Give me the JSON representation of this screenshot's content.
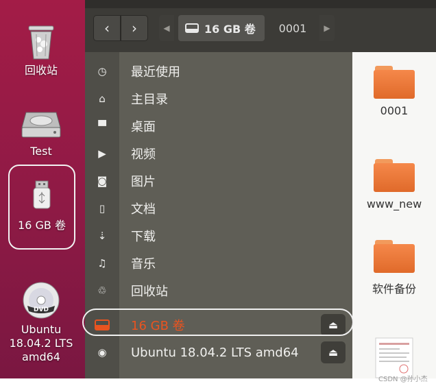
{
  "desktop": {
    "items": [
      {
        "label": "回收站",
        "icon": "trash-icon"
      },
      {
        "label": "Test",
        "icon": "hard-drive-icon"
      },
      {
        "label": "16 GB 卷",
        "icon": "usb-drive-icon",
        "selected": true
      },
      {
        "label": "Ubuntu 18.04.2 LTS amd64",
        "icon": "dvd-icon"
      }
    ]
  },
  "toolbar": {
    "back_icon": "‹",
    "forward_icon": "›",
    "path_left_icon": "◀",
    "path_right_icon": "▶",
    "crumbs": [
      {
        "label": "16 GB 卷",
        "icon": "drive-icon",
        "active": true
      },
      {
        "label": "0001",
        "active": false
      }
    ]
  },
  "sidebar": {
    "items": [
      {
        "label": "最近使用",
        "icon": "clock-icon",
        "glyph": "◷"
      },
      {
        "label": "主目录",
        "icon": "home-icon",
        "glyph": "⌂"
      },
      {
        "label": "桌面",
        "icon": "desktop-folder-icon",
        "glyph": "▀"
      },
      {
        "label": "视频",
        "icon": "video-icon",
        "glyph": "▶"
      },
      {
        "label": "图片",
        "icon": "camera-icon",
        "glyph": "◙"
      },
      {
        "label": "文档",
        "icon": "document-icon",
        "glyph": "▯"
      },
      {
        "label": "下载",
        "icon": "download-icon",
        "glyph": "⇣"
      },
      {
        "label": "音乐",
        "icon": "music-icon",
        "glyph": "♫"
      },
      {
        "label": "回收站",
        "icon": "trash-icon",
        "glyph": "♲"
      },
      {
        "label": "16 GB 卷",
        "icon": "drive-icon",
        "glyph": "▬",
        "active": true,
        "eject": true
      },
      {
        "label": "Ubuntu 18.04.2 LTS amd64",
        "icon": "disc-icon",
        "glyph": "◉",
        "eject": true
      }
    ],
    "eject_glyph": "⏏"
  },
  "content": {
    "items": [
      {
        "label": "0001",
        "type": "folder"
      },
      {
        "label": "www_new",
        "type": "folder"
      },
      {
        "label": "软件备份",
        "type": "folder"
      },
      {
        "label": "",
        "type": "image-thumbnail"
      }
    ]
  },
  "colors": {
    "accent": "#e95420",
    "desktop_bg": "#8e1a45",
    "sidebar_bg": "#5f5e56",
    "toolbar_bg": "#3c3b37"
  },
  "watermark": "CSDN @孙小杰"
}
